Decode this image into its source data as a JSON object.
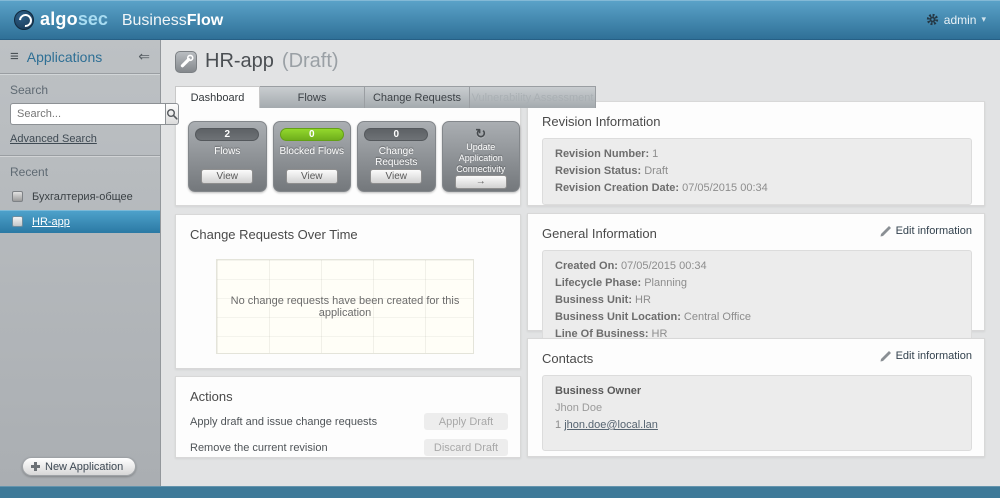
{
  "topbar": {
    "logo_algo": "algo",
    "logo_sec": "sec",
    "logo_business": "Business",
    "logo_flow": "Flow",
    "user": "admin"
  },
  "icons": {
    "hamburger": "≡",
    "collapse_arrow": "⇐",
    "caret_down": "▾",
    "refresh": "↻",
    "arrow_right": "→"
  },
  "colors": {
    "topbar_blue": "#3c80a8",
    "selected_item_blue": "#3a8db8",
    "green_badge": "#7ec center82a",
    "footer_blue": "#3e7a99"
  },
  "sidebar": {
    "title": "Applications",
    "search_label": "Search",
    "search_placeholder": "Search...",
    "advanced_search": "Advanced Search",
    "recent_label": "Recent",
    "recent_items": [
      {
        "label": "Бухгалтерия-общее",
        "selected": false
      },
      {
        "label": "HR-app",
        "selected": true
      }
    ],
    "new_application": "New Application"
  },
  "header": {
    "app_name": "HR-app",
    "app_status": "(Draft)"
  },
  "tabs": [
    {
      "label": "Dashboard",
      "state": "active"
    },
    {
      "label": "Flows",
      "state": "normal"
    },
    {
      "label": "Change Requests",
      "state": "normal"
    },
    {
      "label": "Vulnerability Assessment",
      "state": "disabled"
    }
  ],
  "cards": [
    {
      "count": "2",
      "label": "Flows",
      "button": "View"
    },
    {
      "count": "0",
      "label": "Blocked Flows",
      "button": "View"
    },
    {
      "count": "0",
      "label": "Change Requests",
      "button": "View"
    },
    {
      "label": "Update Application Connectivity",
      "button": "→"
    }
  ],
  "chart": {
    "title": "Change Requests Over Time",
    "empty_message": "No change requests have been created for this application"
  },
  "chart_data": {
    "type": "line",
    "title": "Change Requests Over Time",
    "x": [],
    "series": [],
    "annotations": [
      "No change requests have been created for this application"
    ],
    "grid": true
  },
  "actions": {
    "title": "Actions",
    "rows": [
      {
        "label": "Apply draft and issue change requests",
        "button": "Apply Draft"
      },
      {
        "label": "Remove the current revision",
        "button": "Discard Draft"
      }
    ]
  },
  "revision_info": {
    "title": "Revision Information",
    "fields": [
      {
        "label": "Revision Number:",
        "value": "1"
      },
      {
        "label": "Revision Status:",
        "value": "Draft"
      },
      {
        "label": "Revision Creation Date:",
        "value": "07/05/2015 00:34"
      }
    ]
  },
  "general_info": {
    "title": "General Information",
    "edit_label": "Edit information",
    "fields": [
      {
        "label": "Created On:",
        "value": "07/05/2015 00:34"
      },
      {
        "label": "Lifecycle Phase:",
        "value": "Planning"
      },
      {
        "label": "Business Unit:",
        "value": "HR"
      },
      {
        "label": "Business Unit Location:",
        "value": "Central Office"
      },
      {
        "label": "Line Of Business:",
        "value": "HR"
      }
    ]
  },
  "contacts": {
    "title": "Contacts",
    "edit_label": "Edit information",
    "role": "Business Owner",
    "name": "Jhon Doe",
    "email_prefix": "1",
    "email": "jhon.doe@local.lan"
  }
}
